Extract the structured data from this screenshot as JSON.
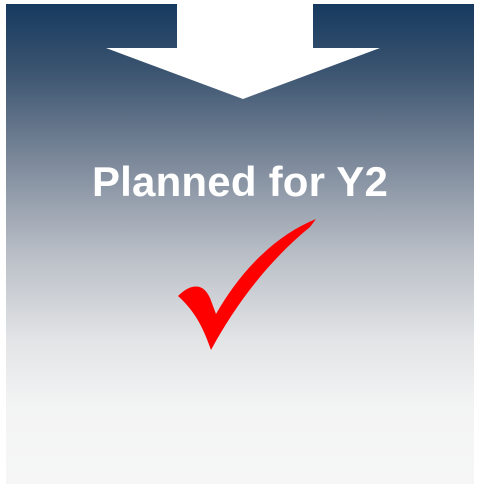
{
  "panel": {
    "label": "Planned for Y2"
  },
  "icons": {
    "arrow": "down-arrow-icon",
    "check": "checkmark-icon"
  },
  "colors": {
    "gradient_top": "#163a5f",
    "gradient_bottom": "#f6f6f6",
    "arrow": "#ffffff",
    "label": "#ffffff",
    "check": "#ff0000"
  }
}
